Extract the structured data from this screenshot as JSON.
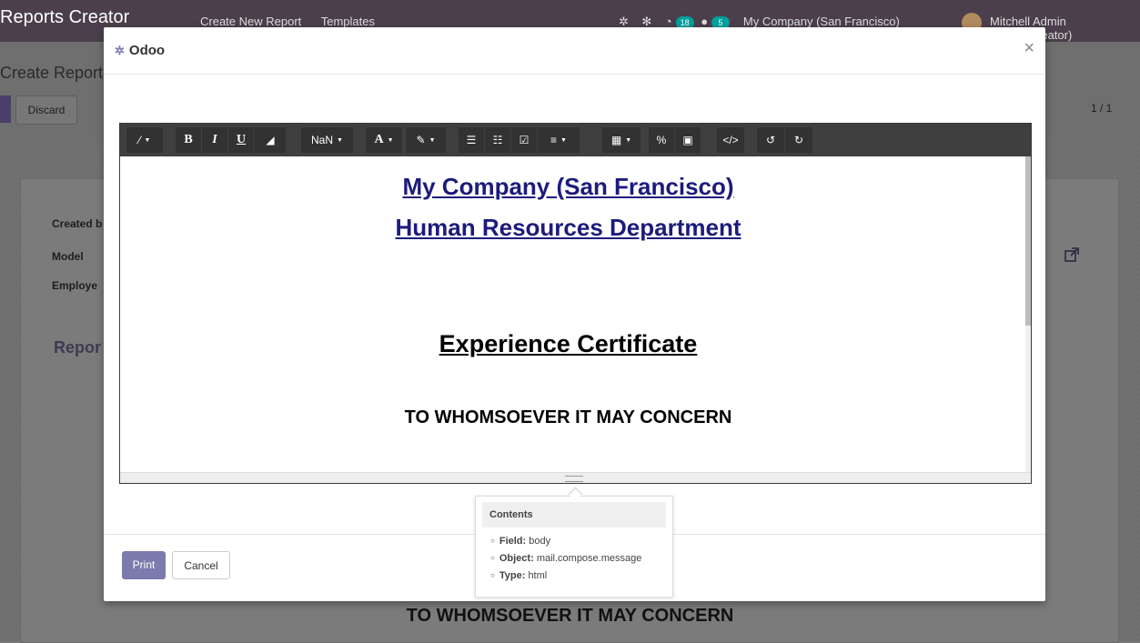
{
  "background": {
    "app_title": "Reports Creator",
    "menu": [
      "Create New Report",
      "Templates"
    ],
    "message_count": "18",
    "activity_count": "5",
    "company": "My Company (San Francisco)",
    "user": "Mitchell Admin (report_creator)",
    "breadcrumb": "Create Reports / s",
    "discard_label": "Discard",
    "pager": "1 / 1",
    "labels": {
      "created": "Created b",
      "model": "Model",
      "employee": "Employe"
    },
    "section": "Repor",
    "bottom_text": "TO WHOMSOEVER IT MAY CONCERN"
  },
  "modal": {
    "title": "Odoo",
    "close": "×",
    "toolbar": {
      "font_size": "NaN",
      "bold": "B",
      "italic": "I",
      "underline": "U",
      "font_color": "A"
    },
    "content": {
      "company": "My Company (San Francisco)",
      "department": "Human Resources Department",
      "heading": "Experience Certificate",
      "subheading": "TO WHOMSOEVER IT MAY CONCERN"
    },
    "tooltip": {
      "title": "Contents",
      "items": [
        {
          "key": "Field:",
          "value": "body"
        },
        {
          "key": "Object:",
          "value": "mail.compose.message"
        },
        {
          "key": "Type:",
          "value": "html"
        }
      ]
    },
    "footer": {
      "print_label": "Print",
      "cancel_label": "Cancel"
    }
  },
  "colors": {
    "accent": "#7c7bad",
    "link_blue": "#1c1c7c",
    "toolbar": "#3f3f3f"
  }
}
